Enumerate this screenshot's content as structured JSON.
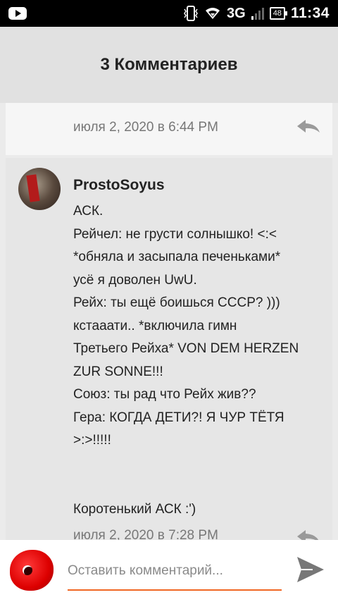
{
  "status_bar": {
    "network": "3G",
    "battery": "48",
    "time": "11:34"
  },
  "header": {
    "title": "3 Комментариев"
  },
  "previous_comment": {
    "date": "июля 2, 2020 в 6:44 PM"
  },
  "comment": {
    "author": "ProstoSoyus",
    "lines": [
      "АСК.",
      "Рейчел: не грусти солнышко! <:<",
      "*обняла и засыпала печеньками*",
      "усё я доволен UwU.",
      "Рейх: ты ещё боишься СССР? )))",
      "кстааати.. *включила гимн",
      "Третьего Рейха* VON DEM HERZEN",
      "ZUR SONNE!!!",
      "Союз: ты рад что Рейх жив??",
      "Гера: КОГДА ДЕТИ?! Я ЧУР ТЁТЯ",
      ">:>!!!!!",
      "",
      "",
      "Коротенький АСК :')"
    ],
    "date": "июля 2, 2020 в 7:28 PM"
  },
  "input_bar": {
    "placeholder": "Оставить комментарий..."
  },
  "colors": {
    "accent": "#f06724",
    "header_bg": "#e1e1e1",
    "card_bg": "#e6e6e6"
  },
  "icons": [
    "youtube-icon",
    "vibrate-icon",
    "wifi-icon",
    "signal-icon",
    "reply-icon",
    "send-icon"
  ]
}
